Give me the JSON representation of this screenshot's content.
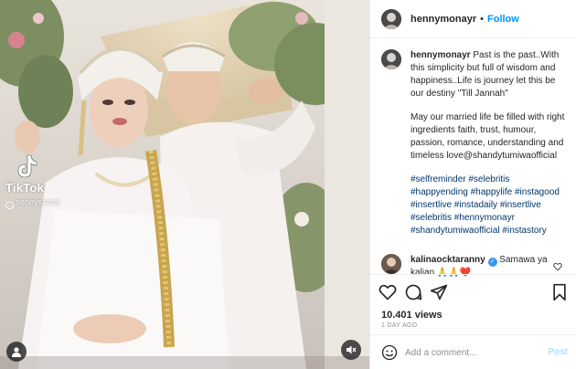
{
  "post": {
    "username": "hennymonayr",
    "follow_label": "Follow",
    "separator": "•"
  },
  "media": {
    "watermark_brand": "TikTok",
    "watermark_user": "hennysandy",
    "tag_icon": "user-tag-icon",
    "mute_icon": "speaker-muted-icon"
  },
  "caption": {
    "username": "hennymonayr",
    "text": "Past is the past..With this simplicity but full of wisdom and happiness..Life is journey let this be our destiny \"Till Jannah\"",
    "paragraph2": "May our married life be filled with right ingredients faith, trust, humour, passion, romance, understanding and timeless love@shandytumiwaofficial",
    "hashtag_lines": [
      "#selfreminder #selebritis",
      "#happyending #happylife #instagood",
      "#insertlive #instadaily #insertlive",
      "#selebritis #hennymonayr",
      "#shandytumiwaofficial #instastory"
    ],
    "age": "1d"
  },
  "comment": {
    "username": "kalinaocktaranny",
    "text": "Samawa ya kalian",
    "emojis": "🙏🙏❤️"
  },
  "actions": {
    "icons": [
      "heart-icon",
      "comment-icon",
      "share-icon",
      "bookmark-icon"
    ],
    "views": "10.401 views",
    "time_ago": "1 DAY AGO"
  },
  "add_comment": {
    "placeholder": "Add a comment...",
    "post_label": "Post",
    "emoji_icon": "smiley-icon"
  },
  "colors": {
    "accent": "#0095f6",
    "hashtag": "#00376b",
    "muted": "#8e8e8e",
    "border": "#efefef",
    "post_disabled": "#b2dffc"
  }
}
